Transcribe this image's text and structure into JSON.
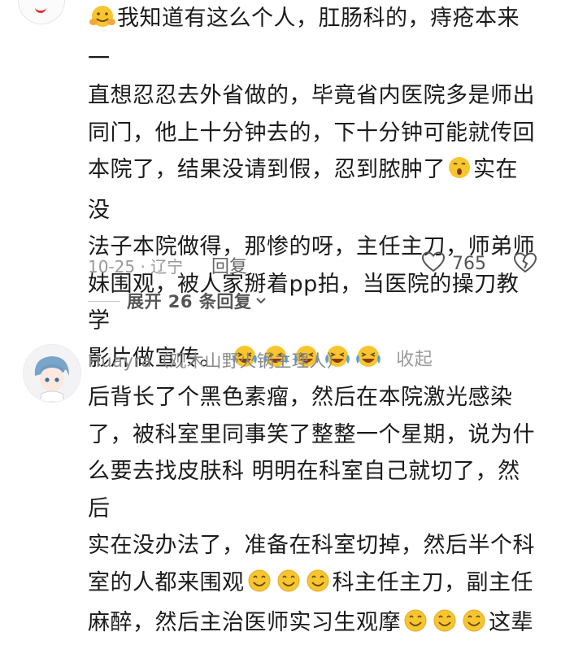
{
  "comment1": {
    "lines": [
      "我知道有这么个人，肛肠科的，痔疮本来一",
      "直想忍忍去外省做的，毕竟省内医院多是师出",
      "同门，他上十分钟去的，下十分钟可能就传回",
      "本院了，结果没请到假，忍到脓肿了",
      "实在没",
      "法子本院做得，那惨的呀，主任主刀，师弟师",
      "妹围观，被人家掰着pp拍，当医院的操刀教学",
      "影片做宣传。"
    ],
    "collapse_label": "收起",
    "date_location": "10-25 · 辽宁",
    "reply_label": "回复",
    "like_count": "765",
    "expand_label": "展开 26 条回复"
  },
  "comment2": {
    "username": "Huayra（观木山野火锅主理人）",
    "lines": [
      "后背长了个黑色素瘤，然后在本院激光感染",
      "了，被科室里同事笑了整整一个星期，说为什",
      "么要去找皮肤科 明明在科室自己就切了，然后",
      "实在没办法了，准备在科室切掉，然后半个科",
      "室的人都来围观",
      "科主任主刀，副主任",
      "麻醉，然后主治医师实习生观摩",
      "这辈"
    ]
  },
  "icons": {
    "hug": "hugging-face-icon",
    "yawn": "yawning-face-icon",
    "laugh": "laughing-crying-face-icon",
    "smile": "smiling-face-icon",
    "like": "heart-icon",
    "dislike": "broken-heart-icon",
    "chevron": "chevron-down-icon"
  }
}
